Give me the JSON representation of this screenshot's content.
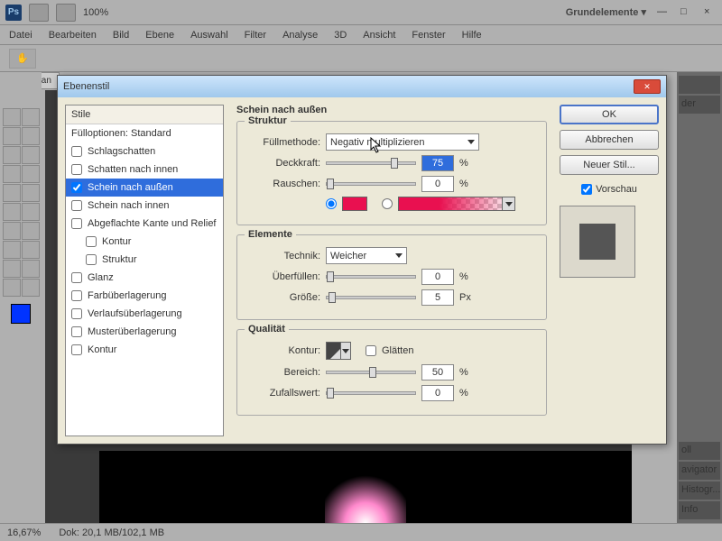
{
  "header": {
    "workspace": "Grundelemente ▾",
    "zoom_hdr": "100%"
  },
  "menu": [
    "Datei",
    "Bearbeiten",
    "Bild",
    "Ebene",
    "Auswahl",
    "Filter",
    "Analyse",
    "3D",
    "Ansicht",
    "Fenster",
    "Hilfe"
  ],
  "doc_tab": "ballerman",
  "dialog": {
    "title": "Ebenenstil",
    "styles_header": "Stile",
    "fill_opts": "Fülloptionen: Standard",
    "items": [
      {
        "label": "Schlagschatten",
        "checked": false
      },
      {
        "label": "Schatten nach innen",
        "checked": false
      },
      {
        "label": "Schein nach außen",
        "checked": true,
        "selected": true
      },
      {
        "label": "Schein nach innen",
        "checked": false
      },
      {
        "label": "Abgeflachte Kante und Relief",
        "checked": false
      },
      {
        "label": "Kontur",
        "checked": false,
        "sub": true
      },
      {
        "label": "Struktur",
        "checked": false,
        "sub": true
      },
      {
        "label": "Glanz",
        "checked": false
      },
      {
        "label": "Farbüberlagerung",
        "checked": false
      },
      {
        "label": "Verlaufsüberlagerung",
        "checked": false
      },
      {
        "label": "Musterüberlagerung",
        "checked": false
      },
      {
        "label": "Kontur",
        "checked": false
      }
    ],
    "section_title": "Schein nach außen",
    "struktur": {
      "legend": "Struktur",
      "blend_label": "Füllmethode:",
      "blend_value": "Negativ multiplizieren",
      "opacity_label": "Deckkraft:",
      "opacity_value": "75",
      "opacity_unit": "%",
      "noise_label": "Rauschen:",
      "noise_value": "0",
      "noise_unit": "%",
      "color_hex": "#e91050"
    },
    "elemente": {
      "legend": "Elemente",
      "tech_label": "Technik:",
      "tech_value": "Weicher",
      "spread_label": "Überfüllen:",
      "spread_value": "0",
      "spread_unit": "%",
      "size_label": "Größe:",
      "size_value": "5",
      "size_unit": "Px"
    },
    "qualitaet": {
      "legend": "Qualität",
      "contour_label": "Kontur:",
      "antialias_label": "Glätten",
      "range_label": "Bereich:",
      "range_value": "50",
      "range_unit": "%",
      "jitter_label": "Zufallswert:",
      "jitter_value": "0",
      "jitter_unit": "%"
    },
    "buttons": {
      "ok": "OK",
      "cancel": "Abbrechen",
      "new_style": "Neuer Stil...",
      "preview": "Vorschau"
    }
  },
  "right_docks": [
    "",
    "",
    "der",
    "",
    "",
    "",
    "oll",
    "",
    "avigator",
    "Histogr...",
    "Info"
  ],
  "status": {
    "zoom": "16,67%",
    "doc": "Dok: 20,1 MB/102,1 MB"
  }
}
